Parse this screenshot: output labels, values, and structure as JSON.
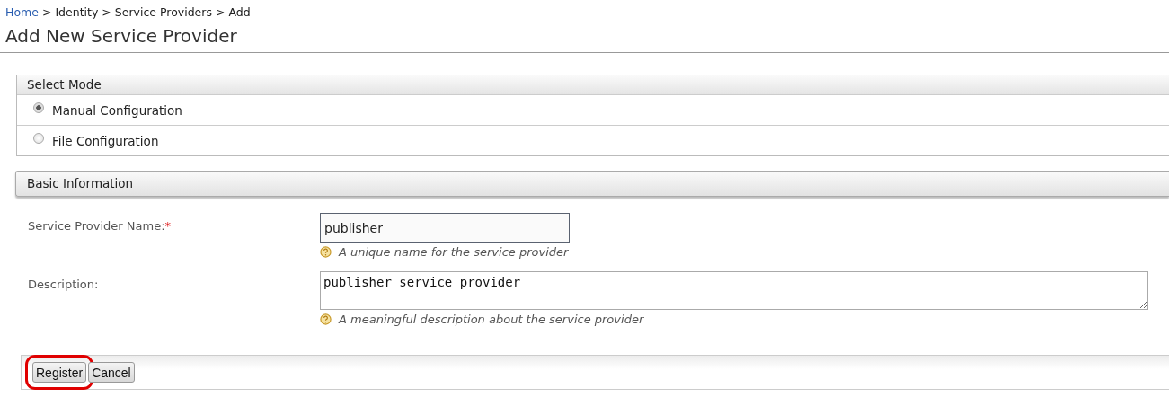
{
  "breadcrumb": [
    {
      "label": "Home",
      "link": true
    },
    {
      "label": "Identity",
      "link": false
    },
    {
      "label": "Service Providers",
      "link": false
    },
    {
      "label": "Add",
      "link": false
    }
  ],
  "breadcrumb_separator": ">",
  "title": "Add New Service Provider",
  "select_mode": {
    "heading": "Select Mode",
    "options": [
      {
        "label": "Manual Configuration",
        "selected": true
      },
      {
        "label": "File Configuration",
        "selected": false
      }
    ]
  },
  "basic_information": {
    "heading": "Basic Information",
    "fields": [
      {
        "kind": "text",
        "label": "Service Provider Name:",
        "required_mark": "*",
        "value": "publisher",
        "help": "A unique name for the service provider"
      },
      {
        "kind": "textarea",
        "label": "Description:",
        "value": "publisher service provider",
        "help": "A meaningful description about the service provider"
      }
    ]
  },
  "buttons": [
    {
      "label": "Register",
      "highlighted": true
    },
    {
      "label": "Cancel",
      "highlighted": false
    }
  ]
}
